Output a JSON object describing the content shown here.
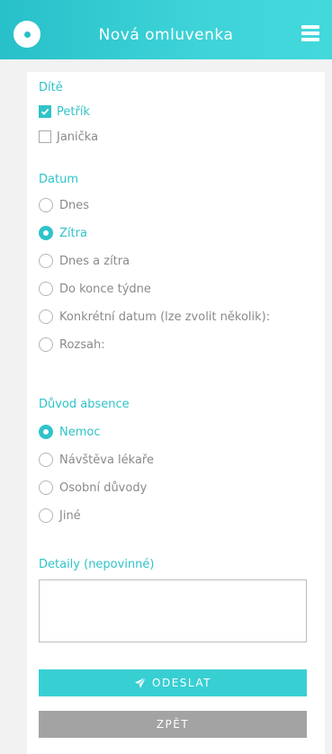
{
  "header": {
    "title": "Nová omluvenka",
    "logo_icon": "logo-dot-icon",
    "menu_icon": "hamburger-menu-icon",
    "gradient": [
      "#28c0c9",
      "#43d8dc"
    ]
  },
  "colors": {
    "accent": "#2fc3c9",
    "send_button": "#38cfd3",
    "back_button": "#a3a3a3",
    "text": "#8a8a8a",
    "background": "#f2f2f2"
  },
  "child": {
    "label": "Dítě",
    "options": [
      {
        "label": "Petřík",
        "checked": true
      },
      {
        "label": "Janička",
        "checked": false
      }
    ]
  },
  "date": {
    "label": "Datum",
    "options": [
      {
        "label": "Dnes",
        "selected": false
      },
      {
        "label": "Zítra",
        "selected": true
      },
      {
        "label": "Dnes a zítra",
        "selected": false
      },
      {
        "label": "Do konce týdne",
        "selected": false
      },
      {
        "label": "Konkrétní datum (lze zvolit několik):",
        "selected": false
      },
      {
        "label": "Rozsah:",
        "selected": false
      }
    ]
  },
  "reason": {
    "label": "Důvod absence",
    "options": [
      {
        "label": "Nemoc",
        "selected": true
      },
      {
        "label": "Návštěva lékaře",
        "selected": false
      },
      {
        "label": "Osobní důvody",
        "selected": false
      },
      {
        "label": "Jiné",
        "selected": false
      }
    ]
  },
  "details": {
    "label": "Detaily (nepovinné)",
    "value": ""
  },
  "buttons": {
    "send_label": "ODESLAT",
    "send_icon": "paper-plane-icon",
    "back_label": "ZPĚT"
  }
}
